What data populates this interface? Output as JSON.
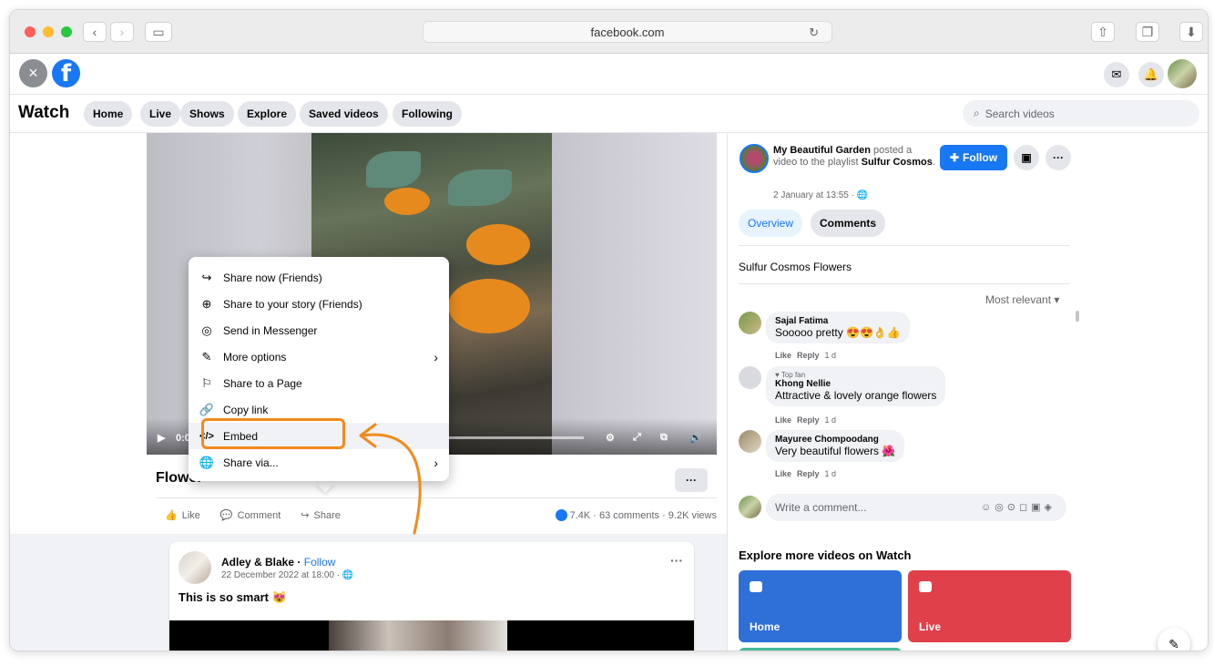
{
  "browser": {
    "url": "facebook.com"
  },
  "watch": {
    "title": "Watch",
    "nav": [
      "Home",
      "Live",
      "Shows",
      "Explore",
      "Saved videos",
      "Following"
    ],
    "search_placeholder": "Search videos"
  },
  "video": {
    "time": "0:01",
    "title": "Flower",
    "more": "···",
    "actions": {
      "like": "Like",
      "comment": "Comment",
      "share": "Share"
    },
    "stats": "7.4K · 63 comments · 9.2K views"
  },
  "share_menu": {
    "items": [
      {
        "label": "Share now (Friends)",
        "icon": "share-arrow-icon"
      },
      {
        "label": "Share to your story (Friends)",
        "icon": "plus-circle-icon"
      },
      {
        "label": "Send in Messenger",
        "icon": "messenger-icon"
      },
      {
        "label": "More options",
        "icon": "edit-icon",
        "submenu": true
      },
      {
        "label": "Share to a Page",
        "icon": "flag-icon"
      },
      {
        "label": "Copy link",
        "icon": "link-icon"
      },
      {
        "label": "Embed",
        "icon": "code-icon",
        "highlighted": true
      },
      {
        "label": "Share via...",
        "icon": "globe-icon",
        "submenu": true
      }
    ]
  },
  "sidebar": {
    "page_name": "My Beautiful Garden",
    "posted_text": " posted a video to the playlist ",
    "playlist": "Sulfur Cosmos",
    "date": "2 January at 13:55 · ",
    "follow": "Follow",
    "tabs": {
      "overview": "Overview",
      "comments": "Comments"
    },
    "playlist_title": "Sulfur Cosmos Flowers",
    "sort": "Most relevant",
    "comments": [
      {
        "name": "Sajal Fatima",
        "badge": "",
        "text": "Sooooo pretty 😍😍👌👍",
        "meta": [
          "Like",
          "Reply",
          "1 d"
        ]
      },
      {
        "name": "Khong Nellie",
        "badge": "♥ Top fan",
        "text": "Attractive & lovely orange flowers",
        "meta": [
          "Like",
          "Reply",
          "1 d"
        ]
      },
      {
        "name": "Mayuree Chompoodang",
        "badge": "",
        "text": "Very beautiful flowers 🌺",
        "meta": [
          "Like",
          "Reply",
          "1 d"
        ]
      }
    ],
    "write_placeholder": "Write a comment...",
    "explore_title": "Explore more videos on Watch",
    "tiles": {
      "home": "Home",
      "live": "Live"
    }
  },
  "feed_post": {
    "author": "Adley & Blake",
    "follow": "Follow",
    "date": "22 December 2022 at 18:00 · ",
    "text": "This is so smart 😻",
    "more": "···"
  },
  "colors": {
    "fb_blue": "#1877f2",
    "highlight_orange": "#f28a1d"
  }
}
